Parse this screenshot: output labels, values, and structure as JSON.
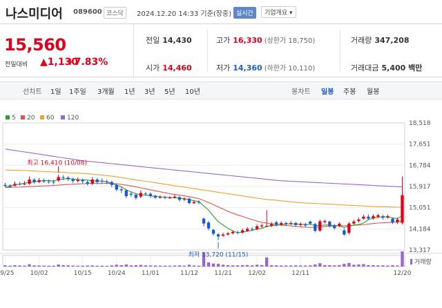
{
  "header": {
    "name": "나스미디어",
    "code": "089600",
    "market": "코스닥",
    "datetime": "2024.12.20 14:33  기준(장중)",
    "realtime": "실시간",
    "company": "기업개요 ▾"
  },
  "quote": {
    "price": "15,560",
    "change_label": "전일대비",
    "change": "▲1,130",
    "change_pct": "+7.83%",
    "prev_label": "전일",
    "prev": "14,430",
    "high_label": "고가",
    "high": "16,330",
    "upper_label": "(상한가 18,750)",
    "vol_label": "거래량",
    "vol": "347,208",
    "open_label": "시가",
    "open": "14,460",
    "low_label": "저가",
    "low": "14,360",
    "lower_label": "(하한가 10,110)",
    "amt_label": "거래대금",
    "amt": "5,400 백만"
  },
  "controls": {
    "line_label": "선차트",
    "periods": [
      "1일",
      "1주일",
      "3개월",
      "1년",
      "3년",
      "5년",
      "10년"
    ],
    "candle_label": "봉차트",
    "candle_periods": [
      "일봉",
      "주봉",
      "월봉"
    ],
    "active_candle": "일봉"
  },
  "legend": [
    {
      "label": "5",
      "color": "#2aa02a"
    },
    {
      "label": "20",
      "color": "#e84f4f"
    },
    {
      "label": "60",
      "color": "#f0a030"
    },
    {
      "label": "120",
      "color": "#9966cc"
    }
  ],
  "annotations": {
    "high": "최고 16,410 (10/08)",
    "low": "최저 13,720 (11/15)"
  },
  "volume_label": "거래량",
  "chart_data": {
    "type": "candlestick",
    "yticks": [
      "18,518",
      "17,651",
      "16,784",
      "15,917",
      "15,051",
      "14,184",
      "13,317"
    ],
    "ylim": [
      13317,
      18518
    ],
    "xticks": [
      "09/25",
      "10/02",
      "10/15",
      "10/24",
      "11/01",
      "11/12",
      "11/21",
      "12/02",
      "12/11",
      "12/20"
    ],
    "candles": [
      [
        15980,
        15940,
        16060,
        15900
      ],
      [
        15940,
        15900,
        16000,
        15860
      ],
      [
        15950,
        16020,
        16120,
        15920
      ],
      [
        16020,
        16010,
        16110,
        15960
      ],
      [
        16000,
        16030,
        16140,
        15970
      ],
      [
        16030,
        16200,
        16330,
        15980
      ],
      [
        16200,
        16100,
        16250,
        16020
      ],
      [
        16100,
        16170,
        16260,
        16050
      ],
      [
        16170,
        16120,
        16240,
        16060
      ],
      [
        16120,
        16110,
        16200,
        16030
      ],
      [
        16110,
        16080,
        16190,
        16000
      ],
      [
        16160,
        16300,
        16410,
        16100
      ],
      [
        16300,
        16270,
        16380,
        16180
      ],
      [
        16280,
        16210,
        16350,
        16150
      ],
      [
        16210,
        16140,
        16280,
        16060
      ],
      [
        16140,
        16190,
        16290,
        16080
      ],
      [
        16190,
        16130,
        16250,
        16040
      ],
      [
        16100,
        16030,
        16180,
        15950
      ],
      [
        16030,
        16200,
        16300,
        15980
      ],
      [
        16200,
        16100,
        16270,
        16010
      ],
      [
        16150,
        16120,
        16250,
        16050
      ],
      [
        16120,
        16090,
        16200,
        16010
      ],
      [
        16100,
        15980,
        16150,
        15880
      ],
      [
        15980,
        15790,
        16030,
        15720
      ],
      [
        15800,
        15760,
        15880,
        15650
      ],
      [
        15760,
        15520,
        15800,
        15440
      ],
      [
        15620,
        15580,
        15700,
        15500
      ],
      [
        15580,
        15450,
        15640,
        15380
      ],
      [
        15500,
        15650,
        15760,
        15440
      ],
      [
        15630,
        15620,
        15700,
        15540
      ],
      [
        15620,
        15530,
        15680,
        15460
      ],
      [
        15530,
        15460,
        15580,
        15400
      ],
      [
        15470,
        15480,
        15560,
        15420
      ],
      [
        15480,
        15450,
        15540,
        15400
      ],
      [
        15460,
        15460,
        15520,
        15410
      ],
      [
        15460,
        15500,
        15580,
        15420
      ],
      [
        15480,
        15370,
        15520,
        15300
      ],
      [
        15370,
        15400,
        15480,
        15330
      ],
      [
        15420,
        15240,
        15460,
        15180
      ],
      [
        15230,
        15280,
        15360,
        15200
      ],
      [
        15280,
        15250,
        15350,
        15190
      ],
      [
        14600,
        14400,
        14650,
        14280
      ],
      [
        14440,
        14200,
        14500,
        14120
      ],
      [
        14140,
        13980,
        14190,
        13900
      ],
      [
        13960,
        13870,
        14010,
        13720
      ],
      [
        13900,
        13950,
        14020,
        13860
      ],
      [
        13950,
        14000,
        14060,
        13900
      ],
      [
        14000,
        14060,
        14120,
        13950
      ],
      [
        14050,
        14020,
        14110,
        13960
      ],
      [
        14030,
        14120,
        14200,
        13980
      ],
      [
        14100,
        14180,
        14260,
        14060
      ],
      [
        14180,
        14160,
        14260,
        14090
      ],
      [
        14180,
        14290,
        14360,
        14120
      ],
      [
        14280,
        14320,
        14400,
        14220
      ],
      [
        14300,
        14300,
        14950,
        14250
      ],
      [
        14320,
        14380,
        14460,
        14250
      ],
      [
        14450,
        14350,
        14520,
        14280
      ],
      [
        14360,
        14420,
        14490,
        14300
      ],
      [
        14420,
        14380,
        14480,
        14300
      ],
      [
        14390,
        14420,
        14500,
        14330
      ],
      [
        14420,
        14340,
        14480,
        14260
      ],
      [
        14340,
        14380,
        14450,
        14280
      ],
      [
        14370,
        14320,
        14440,
        14250
      ],
      [
        14480,
        14400,
        14520,
        14340
      ],
      [
        14380,
        14100,
        14420,
        14040
      ],
      [
        14110,
        14490,
        14560,
        14060
      ],
      [
        14460,
        14500,
        14560,
        14400
      ],
      [
        14480,
        14300,
        14520,
        14240
      ],
      [
        14320,
        14210,
        14380,
        14150
      ],
      [
        14310,
        14390,
        14450,
        14250
      ],
      [
        14120,
        13950,
        14200,
        13900
      ],
      [
        14020,
        14400,
        14460,
        13950
      ],
      [
        14400,
        14480,
        14550,
        14360
      ],
      [
        14500,
        14560,
        14640,
        14440
      ],
      [
        14600,
        14680,
        14760,
        14560
      ],
      [
        14680,
        14600,
        14780,
        14540
      ],
      [
        14620,
        14700,
        14780,
        14560
      ],
      [
        14680,
        14740,
        14800,
        14620
      ],
      [
        14700,
        14640,
        14760,
        14560
      ],
      [
        14650,
        14700,
        14760,
        14600
      ],
      [
        14600,
        14440,
        14650,
        14380
      ],
      [
        14460,
        14560,
        14640,
        14380
      ],
      [
        14430,
        15560,
        16330,
        14360
      ]
    ],
    "ma5": [
      15900,
      15950,
      15990,
      16010,
      16060,
      16080,
      16100,
      16140,
      16160,
      16160,
      16140,
      16200,
      16220,
      16240,
      16220,
      16200,
      16180,
      16180,
      16140,
      16140,
      16130,
      16110,
      16040,
      15980,
      15900,
      15780,
      15700,
      15620,
      15580,
      15560,
      15530,
      15520,
      15490,
      15480,
      15460,
      15460,
      15440,
      15420,
      15380,
      15330,
      15300,
      15120,
      14950,
      14700,
      14480,
      14340,
      14200,
      14100,
      14020,
      14050,
      14080,
      14120,
      14170,
      14200,
      14280,
      14310,
      14330,
      14350,
      14380,
      14390,
      14380,
      14370,
      14360,
      14370,
      14320,
      14320,
      14340,
      14340,
      14320,
      14300,
      14240,
      14280,
      14340,
      14360,
      14420,
      14560,
      14620,
      14660,
      14670,
      14670,
      14630,
      14600,
      14720
    ],
    "ma20": [
      15870,
      15880,
      15890,
      15890,
      15900,
      15910,
      15920,
      15930,
      15940,
      15950,
      15960,
      15970,
      15990,
      16000,
      16010,
      16020,
      16030,
      16030,
      16040,
      16040,
      16040,
      16050,
      16040,
      16030,
      16000,
      15970,
      15940,
      15900,
      15860,
      15820,
      15780,
      15740,
      15700,
      15660,
      15620,
      15590,
      15560,
      15530,
      15500,
      15460,
      15420,
      15340,
      15260,
      15170,
      15080,
      14990,
      14900,
      14820,
      14750,
      14690,
      14620,
      14560,
      14500,
      14450,
      14420,
      14390,
      14360,
      14340,
      14320,
      14300,
      14280,
      14260,
      14250,
      14240,
      14250,
      14260,
      14280,
      14290,
      14300,
      14310,
      14310,
      14320,
      14330,
      14340,
      14350,
      14380,
      14400,
      14420,
      14430,
      14440,
      14450,
      14460,
      14500
    ],
    "ma60": [
      16590,
      16585,
      16580,
      16575,
      16570,
      16560,
      16550,
      16540,
      16530,
      16520,
      16510,
      16500,
      16490,
      16480,
      16470,
      16460,
      16450,
      16440,
      16420,
      16400,
      16380,
      16360,
      16340,
      16310,
      16280,
      16250,
      16220,
      16190,
      16160,
      16130,
      16100,
      16070,
      16040,
      16010,
      15980,
      15950,
      15920,
      15890,
      15860,
      15830,
      15800,
      15770,
      15740,
      15710,
      15680,
      15650,
      15620,
      15590,
      15560,
      15530,
      15500,
      15470,
      15440,
      15410,
      15390,
      15370,
      15350,
      15330,
      15310,
      15290,
      15270,
      15250,
      15240,
      15230,
      15220,
      15210,
      15200,
      15190,
      15180,
      15170,
      15160,
      15150,
      15140,
      15130,
      15120,
      15110,
      15100,
      15090,
      15085,
      15080,
      15075,
      15070,
      15070
    ],
    "ma120": [
      17450,
      17420,
      17390,
      17360,
      17330,
      17300,
      17270,
      17240,
      17210,
      17180,
      17150,
      17120,
      17090,
      17060,
      17030,
      17000,
      16970,
      16950,
      16930,
      16910,
      16890,
      16870,
      16850,
      16830,
      16810,
      16790,
      16770,
      16750,
      16730,
      16710,
      16690,
      16670,
      16650,
      16630,
      16610,
      16590,
      16570,
      16550,
      16530,
      16510,
      16490,
      16470,
      16450,
      16430,
      16410,
      16390,
      16370,
      16350,
      16330,
      16310,
      16290,
      16270,
      16250,
      16230,
      16210,
      16190,
      16170,
      16150,
      16140,
      16130,
      16120,
      16110,
      16100,
      16090,
      16080,
      16070,
      16060,
      16050,
      16040,
      16030,
      16020,
      16010,
      16000,
      15990,
      15980,
      15970,
      15960,
      15950,
      15940,
      15930,
      15920,
      15910,
      15900
    ],
    "volume": [
      8,
      6,
      9,
      7,
      6,
      15,
      8,
      7,
      6,
      6,
      6,
      14,
      9,
      8,
      7,
      6,
      6,
      7,
      8,
      6,
      6,
      5,
      8,
      12,
      9,
      14,
      8,
      9,
      11,
      8,
      7,
      7,
      6,
      6,
      6,
      7,
      8,
      6,
      12,
      7,
      6,
      95,
      28,
      20,
      18,
      12,
      9,
      8,
      8,
      9,
      10,
      8,
      12,
      10,
      60,
      9,
      8,
      7,
      7,
      7,
      8,
      7,
      7,
      8,
      14,
      22,
      10,
      9,
      8,
      10,
      18,
      24,
      12,
      14,
      16,
      10,
      9,
      8,
      8,
      7,
      9,
      7,
      100
    ]
  }
}
